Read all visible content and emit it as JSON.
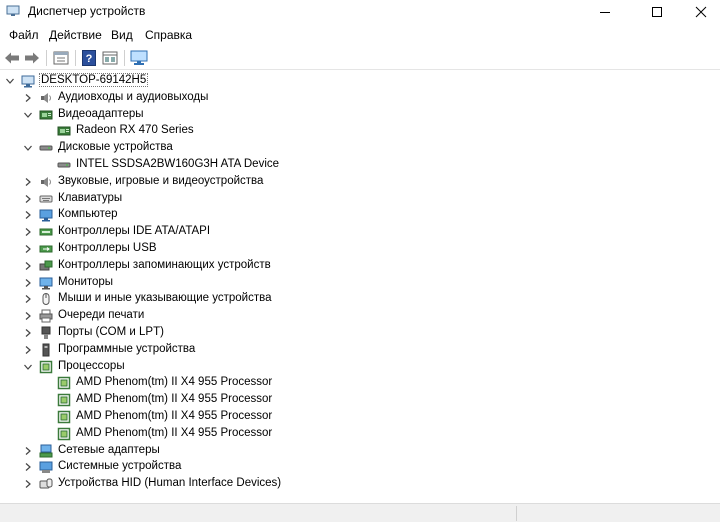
{
  "window": {
    "title": "Диспетчер устройств",
    "controls": {
      "minimize": "minimize-icon",
      "maximize": "maximize-icon",
      "close": "close-icon"
    }
  },
  "menu": [
    "Файл",
    "Действие",
    "Вид",
    "Справка"
  ],
  "toolbar": [
    "back-arrow-icon",
    "forward-arrow-icon",
    "properties-icon",
    "help-icon",
    "view-icon",
    "monitor-scan-icon"
  ],
  "tree": {
    "root": "DESKTOP-69142H5",
    "categories": [
      {
        "label": "Аудиовходы и аудиовыходы",
        "icon": "speaker-icon",
        "expanded": false
      },
      {
        "label": "Видеоадаптеры",
        "icon": "display-adapter-icon",
        "expanded": true,
        "children": [
          {
            "label": "Radeon RX 470 Series",
            "icon": "display-adapter-icon"
          }
        ]
      },
      {
        "label": "Дисковые устройства",
        "icon": "disk-drive-icon",
        "expanded": true,
        "children": [
          {
            "label": "INTEL SSDSA2BW160G3H ATA Device",
            "icon": "disk-drive-icon"
          }
        ]
      },
      {
        "label": "Звуковые, игровые и видеоустройства",
        "icon": "speaker-icon",
        "expanded": false
      },
      {
        "label": "Клавиатуры",
        "icon": "keyboard-icon",
        "expanded": false
      },
      {
        "label": "Компьютер",
        "icon": "computer-icon",
        "expanded": false
      },
      {
        "label": "Контроллеры IDE ATA/ATAPI",
        "icon": "ide-controller-icon",
        "expanded": false
      },
      {
        "label": "Контроллеры USB",
        "icon": "usb-icon",
        "expanded": false
      },
      {
        "label": "Контроллеры запоминающих устройств",
        "icon": "storage-controller-icon",
        "expanded": false
      },
      {
        "label": "Мониторы",
        "icon": "monitor-icon",
        "expanded": false
      },
      {
        "label": "Мыши и иные указывающие устройства",
        "icon": "mouse-icon",
        "expanded": false
      },
      {
        "label": "Очереди печати",
        "icon": "printer-icon",
        "expanded": false
      },
      {
        "label": "Порты (COM и LPT)",
        "icon": "port-icon",
        "expanded": false
      },
      {
        "label": "Программные устройства",
        "icon": "software-device-icon",
        "expanded": false
      },
      {
        "label": "Процессоры",
        "icon": "processor-icon",
        "expanded": true,
        "children": [
          {
            "label": "AMD Phenom(tm) II X4 955 Processor",
            "icon": "processor-icon"
          },
          {
            "label": "AMD Phenom(tm) II X4 955 Processor",
            "icon": "processor-icon"
          },
          {
            "label": "AMD Phenom(tm) II X4 955 Processor",
            "icon": "processor-icon"
          },
          {
            "label": "AMD Phenom(tm) II X4 955 Processor",
            "icon": "processor-icon"
          }
        ]
      },
      {
        "label": "Сетевые адаптеры",
        "icon": "network-adapter-icon",
        "expanded": false
      },
      {
        "label": "Системные устройства",
        "icon": "system-device-icon",
        "expanded": false
      },
      {
        "label": "Устройства HID (Human Interface Devices)",
        "icon": "hid-icon",
        "expanded": false
      }
    ]
  }
}
